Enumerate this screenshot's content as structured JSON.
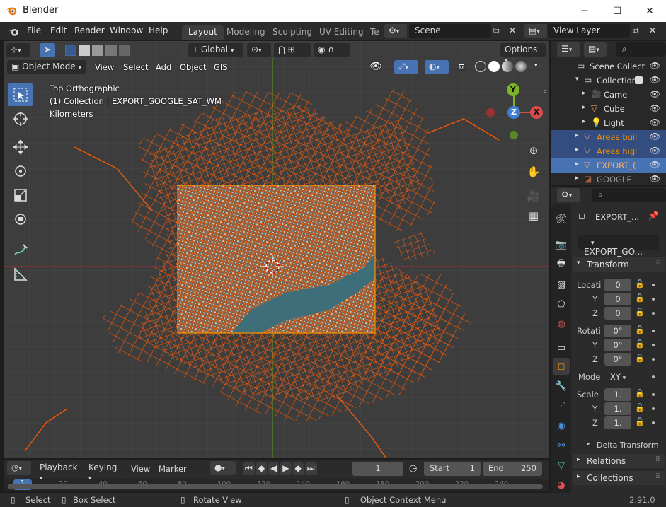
{
  "window": {
    "title": "Blender",
    "min": "─",
    "max": "☐",
    "close": "✕"
  },
  "menu": {
    "items": [
      "File",
      "Edit",
      "Render",
      "Window",
      "Help"
    ],
    "workspaces": [
      "Layout",
      "Modeling",
      "Sculpting",
      "UV Editing",
      "Te"
    ],
    "scene": "Scene",
    "view_layer": "View Layer"
  },
  "viewport": {
    "transform_orientation": "Global",
    "options_label": "Options",
    "mode": "Object Mode",
    "menus": [
      "View",
      "Select",
      "Add",
      "Object",
      "GIS"
    ],
    "overlay_lines": [
      "Top Orthographic",
      "(1) Collection | EXPORT_GOOGLE_SAT_WM",
      "Kilometers"
    ],
    "gizmo": {
      "x": "X",
      "y": "Y",
      "z": "Z"
    }
  },
  "timeline": {
    "menus": [
      "Playback",
      "Keying",
      "View",
      "Marker"
    ],
    "current_frame": "1",
    "start_label": "Start",
    "start": "1",
    "end_label": "End",
    "end": "250",
    "ruler_current": "1",
    "ruler_ticks": [
      "20",
      "40",
      "60",
      "80",
      "100",
      "120",
      "140",
      "160",
      "180",
      "200",
      "220",
      "240"
    ]
  },
  "status": {
    "select": "Select",
    "box_select": "Box Select",
    "rotate_view": "Rotate View",
    "context_menu": "Object Context Menu",
    "version": "2.91.0"
  },
  "outliner": {
    "rows": [
      {
        "label": "Scene Collect",
        "indent": 0,
        "type": "scene"
      },
      {
        "label": "Collection",
        "indent": 1,
        "type": "collection"
      },
      {
        "label": "Came",
        "indent": 2,
        "type": "camera"
      },
      {
        "label": "Cube",
        "indent": 2,
        "type": "mesh"
      },
      {
        "label": "Light",
        "indent": 2,
        "type": "light"
      },
      {
        "label": "Areas:buil",
        "indent": 1,
        "type": "mesh",
        "selected": true
      },
      {
        "label": "Areas:higl",
        "indent": 1,
        "type": "mesh",
        "selected": true
      },
      {
        "label": "EXPORT_(",
        "indent": 1,
        "type": "mesh",
        "selected": true,
        "active": true
      },
      {
        "label": "GOOGLE",
        "indent": 1,
        "type": "image"
      }
    ]
  },
  "properties": {
    "object_name": "EXPORT_...",
    "object_field": "EXPORT_GO...",
    "transform_header": "Transform",
    "location_label": "Locati",
    "rotation_label": "Rotati",
    "axis_y": "Y",
    "axis_z": "Z",
    "location": [
      "0",
      "0",
      "0"
    ],
    "rotation": [
      "0°",
      "0°",
      "0°"
    ],
    "mode_label": "Mode",
    "mode_value": "XY",
    "scale_label": "Scale",
    "scale": [
      "1.",
      "1.",
      "1."
    ],
    "delta_transform": "Delta Transform",
    "relations": "Relations",
    "collections": "Collections"
  },
  "colors": {
    "accent": "#4772b3",
    "roads": "#ff5a00",
    "x_axis": "#9b3232",
    "y_axis": "#5a8a28",
    "selection_outline": "#f08c00"
  }
}
